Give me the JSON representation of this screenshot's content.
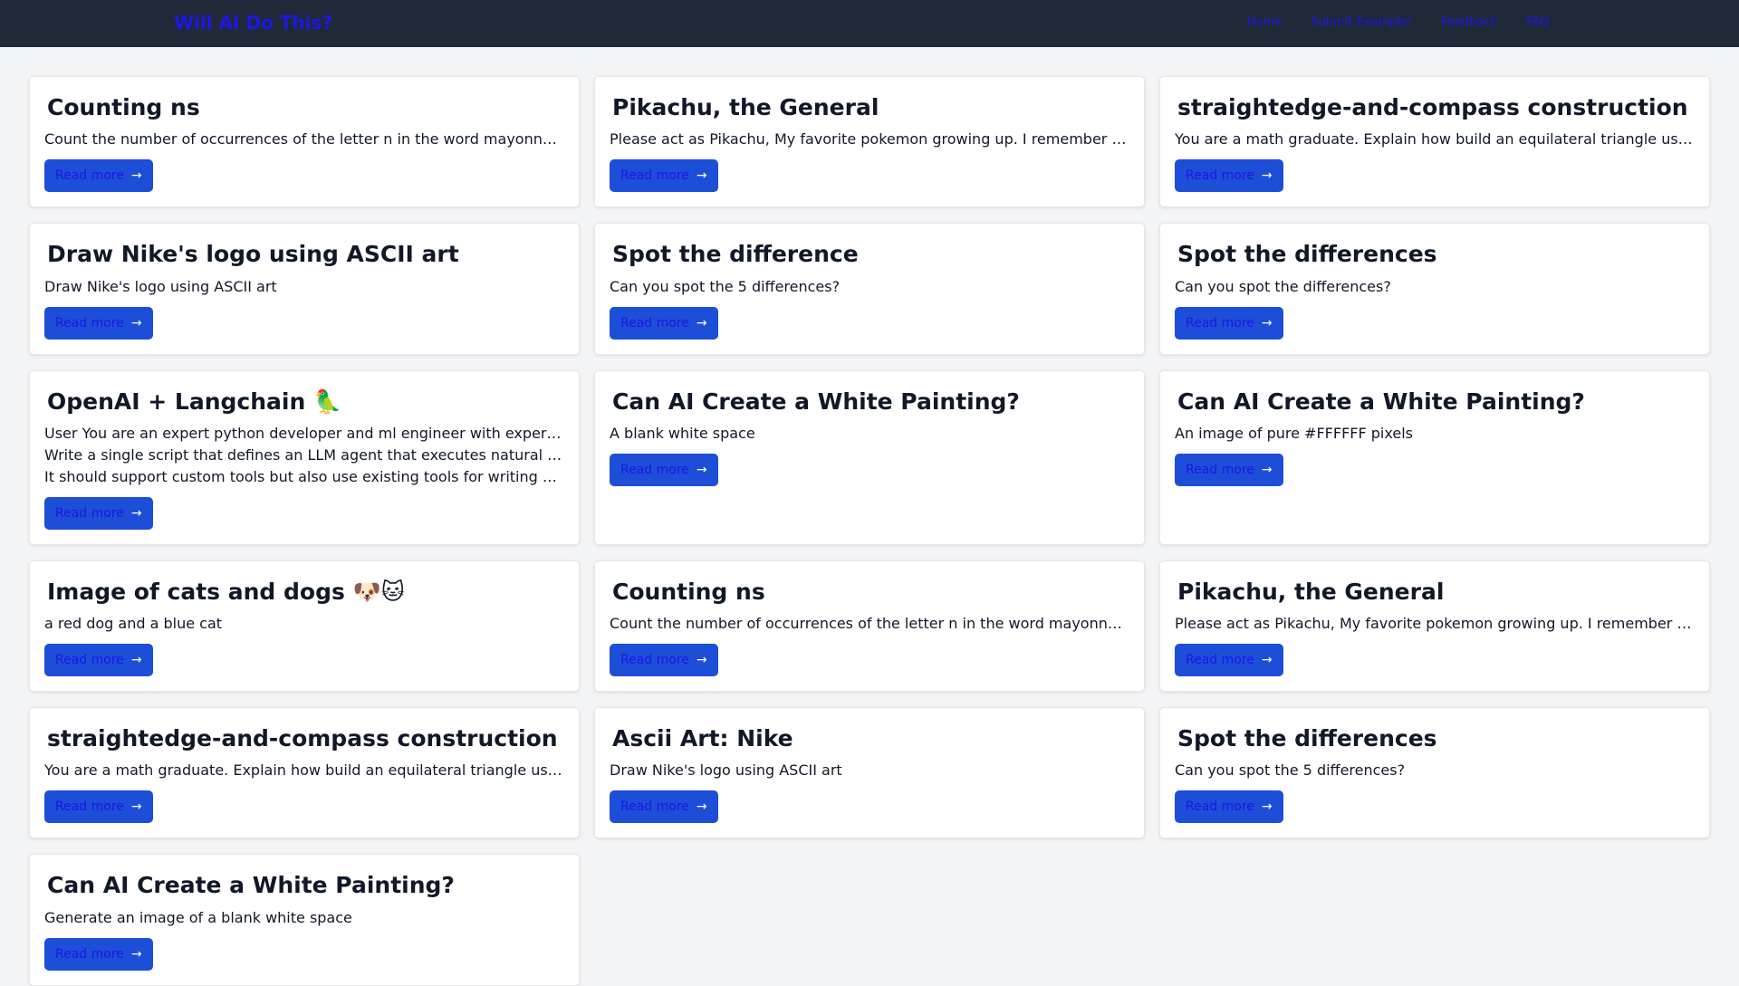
{
  "nav": {
    "brand": "Will AI Do This?",
    "links": [
      "Home",
      "Submit Example!",
      "Feedback",
      "FAQ"
    ]
  },
  "cards": [
    {
      "title": "Counting ns",
      "lines": [
        "Count the number of occurrences of the letter n in the word mayonnaise"
      ],
      "button": "Read more"
    },
    {
      "title": "Pikachu, the General",
      "lines": [
        "Please act as Pikachu, My favorite pokemon growing up. I remember playing"
      ],
      "button": "Read more"
    },
    {
      "title": "straightedge-and-compass construction",
      "lines": [
        "You are a math graduate. Explain how build an equilateral triangle using"
      ],
      "button": "Read more"
    },
    {
      "title": "Draw Nike's logo using ASCII art",
      "lines": [
        "Draw Nike's logo using ASCII art"
      ],
      "button": "Read more"
    },
    {
      "title": "Spot the difference",
      "lines": [
        "Can you spot the 5 differences?"
      ],
      "button": "Read more"
    },
    {
      "title": "Spot the differences",
      "lines": [
        "Can you spot the differences?"
      ],
      "button": "Read more"
    },
    {
      "title": "OpenAI + Langchain 🦜",
      "lines": [
        "User You are an expert python developer and ml engineer with experience",
        "Write a single script that defines an LLM agent that executes natural language",
        "It should support custom tools but also use existing tools for writing files"
      ],
      "button": "Read more"
    },
    {
      "title": "Can AI Create a White Painting?",
      "lines": [
        "A blank white space"
      ],
      "button": "Read more"
    },
    {
      "title": "Can AI Create a White Painting?",
      "lines": [
        "An image of pure #FFFFFF pixels"
      ],
      "button": "Read more"
    },
    {
      "title": "Image of cats and dogs 🐶🐱",
      "lines": [
        "a red dog and a blue cat"
      ],
      "button": "Read more"
    },
    {
      "title": "Counting ns",
      "lines": [
        "Count the number of occurrences of the letter n in the word mayonnaise"
      ],
      "button": "Read more"
    },
    {
      "title": "Pikachu, the General",
      "lines": [
        "Please act as Pikachu, My favorite pokemon growing up. I remember playing"
      ],
      "button": "Read more"
    },
    {
      "title": "straightedge-and-compass construction",
      "lines": [
        "You are a math graduate. Explain how build an equilateral triangle using"
      ],
      "button": "Read more"
    },
    {
      "title": "Ascii Art: Nike",
      "lines": [
        "Draw Nike's logo using ASCII art"
      ],
      "button": "Read more"
    },
    {
      "title": "Spot the differences",
      "lines": [
        "Can you spot the 5 differences?"
      ],
      "button": "Read more"
    },
    {
      "title": "Can AI Create a White Painting?",
      "lines": [
        "Generate an image of a blank white space"
      ],
      "button": "Read more"
    }
  ]
}
